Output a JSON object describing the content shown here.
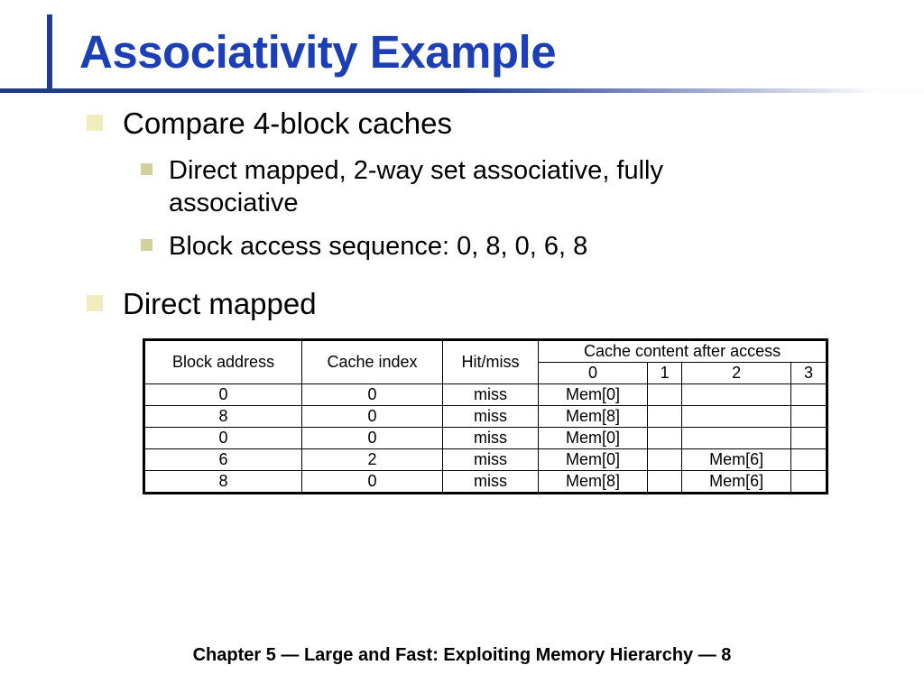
{
  "title": "Associativity Example",
  "bullets": {
    "b1": "Compare 4-block caches",
    "b1a": "Direct mapped, 2-way set associative, fully associative",
    "b1b": "Block access sequence: 0, 8, 0, 6, 8",
    "b2": "Direct mapped"
  },
  "table": {
    "h_block": "Block address",
    "h_index": "Cache index",
    "h_hit": "Hit/miss",
    "h_content": "Cache content after access",
    "cols": {
      "c0": "0",
      "c1": "1",
      "c2": "2",
      "c3": "3"
    },
    "rows": [
      {
        "addr": "0",
        "idx": "0",
        "hm": "miss",
        "c0": {
          "v": "Mem[0]",
          "cls": "mem-new"
        },
        "c1": {
          "v": ""
        },
        "c2": {
          "v": ""
        },
        "c3": {
          "v": ""
        }
      },
      {
        "addr": "8",
        "idx": "0",
        "hm": "miss",
        "c0": {
          "v": "Mem[8]",
          "cls": "mem-repl"
        },
        "c1": {
          "v": ""
        },
        "c2": {
          "v": ""
        },
        "c3": {
          "v": ""
        }
      },
      {
        "addr": "0",
        "idx": "0",
        "hm": "miss",
        "c0": {
          "v": "Mem[0]",
          "cls": "mem-repl"
        },
        "c1": {
          "v": ""
        },
        "c2": {
          "v": ""
        },
        "c3": {
          "v": ""
        }
      },
      {
        "addr": "6",
        "idx": "2",
        "hm": "miss",
        "c0": {
          "v": "Mem[0]",
          "cls": "mem-keep"
        },
        "c1": {
          "v": ""
        },
        "c2": {
          "v": "Mem[6]",
          "cls": "mem-new"
        },
        "c3": {
          "v": ""
        }
      },
      {
        "addr": "8",
        "idx": "0",
        "hm": "miss",
        "c0": {
          "v": "Mem[8]",
          "cls": "mem-repl"
        },
        "c1": {
          "v": ""
        },
        "c2": {
          "v": "Mem[6]",
          "cls": "mem-keep"
        },
        "c3": {
          "v": ""
        }
      }
    ]
  },
  "footer": "Chapter 5 — Large and Fast: Exploiting Memory Hierarchy — 8"
}
